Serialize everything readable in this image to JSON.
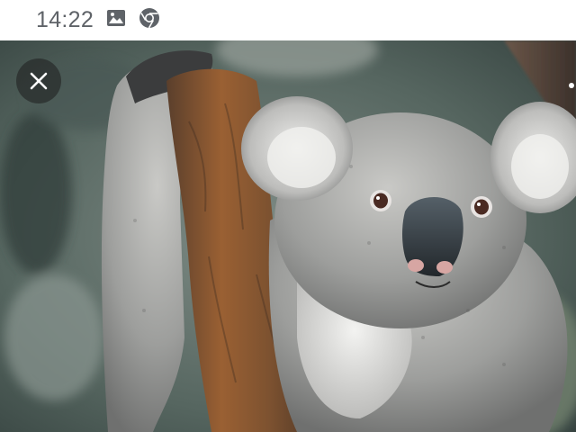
{
  "status_bar": {
    "time": "14:22",
    "icons": [
      "image-icon",
      "chrome-icon"
    ],
    "icon_color": "#5f6368"
  },
  "viewer": {
    "close_icon": "close-icon",
    "image": "koala-photo"
  }
}
